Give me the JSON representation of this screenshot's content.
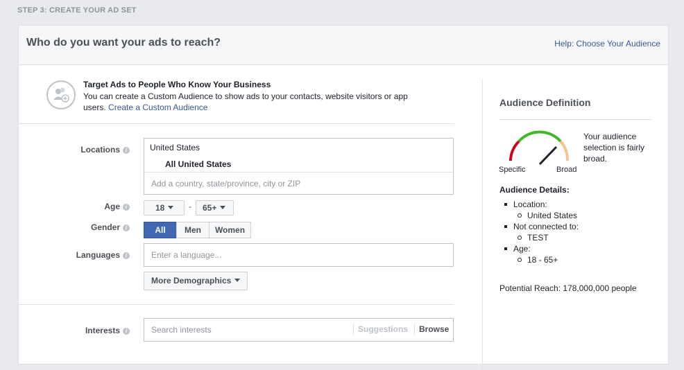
{
  "step": "STEP 3: CREATE YOUR AD SET",
  "header": {
    "title": "Who do you want your ads to reach?",
    "help_link": "Help: Choose Your Audience"
  },
  "custom_audience": {
    "title": "Target Ads to People Who Know Your Business",
    "text": "You can create a Custom Audience to show ads to your contacts, website visitors or app users.",
    "link": "Create a Custom Audience",
    "icon": "people-add-icon"
  },
  "form": {
    "locations_label": "Locations",
    "location_country": "United States",
    "location_all": "All United States",
    "location_placeholder": "Add a country, state/province, city or ZIP",
    "age_label": "Age",
    "age_min": "18",
    "age_sep": "-",
    "age_max": "65+",
    "gender_label": "Gender",
    "gender_all": "All",
    "gender_men": "Men",
    "gender_women": "Women",
    "gender_selected": "All",
    "languages_label": "Languages",
    "languages_placeholder": "Enter a language...",
    "more_demographics": "More Demographics",
    "interests_label": "Interests",
    "interests_placeholder": "Search interests",
    "suggestions": "Suggestions",
    "browse": "Browse",
    "info_glyph": "i"
  },
  "audience_definition": {
    "title": "Audience Definition",
    "gauge_text": "Your audience selection is fairly broad.",
    "specific": "Specific",
    "broad": "Broad",
    "details_title": "Audience Details:",
    "location_label": "Location:",
    "location_value": "United States",
    "not_connected_label": "Not connected to:",
    "not_connected_value": "TEST",
    "age_label": "Age:",
    "age_value": "18 - 65+",
    "potential_reach": "Potential Reach: 178,000,000 people",
    "colors": {
      "specific": "#d0021b",
      "mid": "#42b72a",
      "broad": "#f7c290",
      "needle": "#1d2129"
    }
  }
}
